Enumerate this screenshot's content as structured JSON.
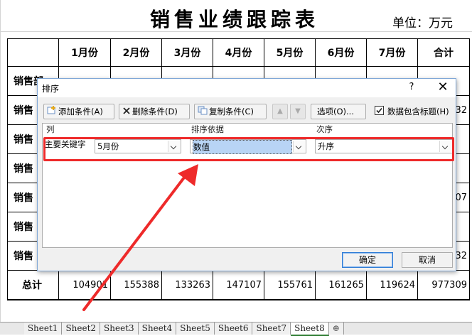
{
  "sheet": {
    "title": "销售业绩跟踪表",
    "unit": "单位：万元",
    "headers": [
      "",
      "1月份",
      "2月份",
      "3月份",
      "4月份",
      "5月份",
      "6月份",
      "7月份",
      "合计"
    ],
    "row_labels": [
      "销售部",
      "销售",
      "销售",
      "销售",
      "销售",
      "销售",
      "销售"
    ],
    "right_partial": [
      "",
      "32",
      "",
      "",
      "07",
      "",
      "32"
    ],
    "total_label": "总计",
    "totals": [
      "104901",
      "155388",
      "133263",
      "147107",
      "155761",
      "161265",
      "119624",
      "977309"
    ]
  },
  "tabs": [
    "Sheet1",
    "Sheet2",
    "Sheet3",
    "Sheet4",
    "Sheet5",
    "Sheet6",
    "Sheet7",
    "Sheet8"
  ],
  "active_tab": "Sheet8",
  "dialog": {
    "title": "排序",
    "help": "?",
    "close": "✕",
    "toolbar": {
      "add": "添加条件(A)",
      "delete": "删除条件(D)",
      "copy": "复制条件(C)",
      "options": "选项(O)...",
      "has_header": "数据包含标题(H)"
    },
    "columns": {
      "col": "列",
      "sort_on": "排序依据",
      "order": "次序"
    },
    "row": {
      "label": "主要关键字",
      "column_value": "5月份",
      "sort_on_value": "数值",
      "order_value": "升序"
    },
    "ok": "确定",
    "cancel": "取消"
  },
  "colors": {
    "highlight": "#ee2a2a",
    "selection": "#b8d4f5"
  }
}
